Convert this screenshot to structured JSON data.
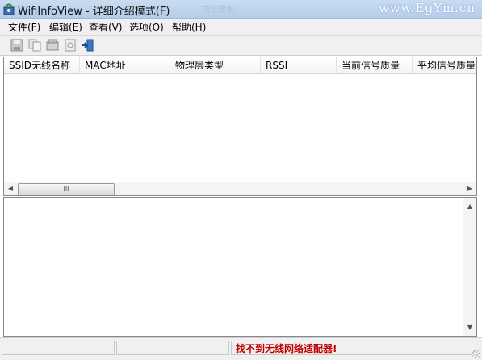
{
  "window": {
    "title": "WifiInfoView  - 详细介绍模式(F)",
    "watermark": "www.EgYm.cn",
    "background_tabs_hint": "          内容搜索"
  },
  "menu": [
    {
      "label": "文件(F)"
    },
    {
      "label": "编辑(E)"
    },
    {
      "label": "查看(V)"
    },
    {
      "label": "选项(O)"
    },
    {
      "label": "帮助(H)"
    }
  ],
  "toolbar": {
    "buttons": [
      "save-icon",
      "copy-icon",
      "properties-icon",
      "html-report-icon",
      "exit-icon"
    ]
  },
  "list": {
    "columns": [
      {
        "label": "SSID无线名称"
      },
      {
        "label": "MAC地址"
      },
      {
        "label": "物理层类型"
      },
      {
        "label": "RSSI"
      },
      {
        "label": "当前信号质量"
      },
      {
        "label": "平均信号质量"
      }
    ],
    "hscroll_thumb_glyph": "III"
  },
  "status": {
    "message": "找不到无线网络适配器!"
  },
  "colors": {
    "title_bar": "#b9d1ea",
    "status_error": "#c00000"
  }
}
